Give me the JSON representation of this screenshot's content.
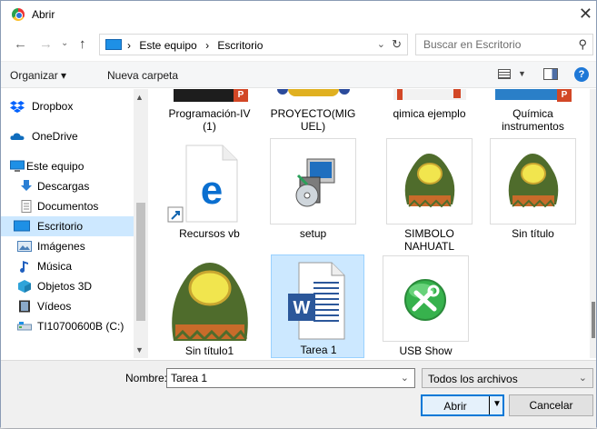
{
  "window": {
    "title": "Abrir",
    "close_glyph": "✕"
  },
  "nav": {
    "back_glyph": "←",
    "forward_glyph": "→",
    "recent_glyph": "⌄",
    "up_glyph": "↑",
    "breadcrumb": [
      "Este equipo",
      "Escritorio"
    ],
    "separator": "›",
    "refresh_glyph": "↻",
    "search_placeholder": "Buscar en Escritorio",
    "search_glyph": "⚲"
  },
  "toolbar": {
    "organize_label": "Organizar ▾",
    "new_folder_label": "Nueva carpeta",
    "help_glyph": "?"
  },
  "sidebar": {
    "items": [
      {
        "label": "Dropbox",
        "icon": "dropbox-icon",
        "color": "#0061fe"
      },
      {
        "label": "OneDrive",
        "icon": "onedrive-icon",
        "color": "#0f6cbd"
      },
      {
        "label": "Este equipo",
        "icon": "computer-icon",
        "color": "#1e90e6"
      },
      {
        "label": "Descargas",
        "icon": "download-icon",
        "color": "#2a7fd4"
      },
      {
        "label": "Documentos",
        "icon": "document-icon",
        "color": "#8a8a8a"
      },
      {
        "label": "Escritorio",
        "icon": "desktop-icon",
        "color": "#1e90e6",
        "selected": true
      },
      {
        "label": "Imágenes",
        "icon": "pictures-icon",
        "color": "#4a7fb8"
      },
      {
        "label": "Música",
        "icon": "music-icon",
        "color": "#1f5fbf"
      },
      {
        "label": "Objetos 3D",
        "icon": "objects-3d-icon",
        "color": "#2fa3d9"
      },
      {
        "label": "Vídeos",
        "icon": "video-icon",
        "color": "#333333"
      },
      {
        "label": "TI10700600B (C:)",
        "icon": "drive-icon",
        "color": "#6b8fb3"
      }
    ]
  },
  "files": {
    "row1": [
      {
        "name": "Programación-IV\n(1)",
        "icon": "presentation-icon"
      },
      {
        "name": "PROYECTO(MIG\nUEL)",
        "icon": "image-icon"
      },
      {
        "name": "qimica ejemplo",
        "icon": "presentation-icon"
      },
      {
        "name": "Química\ninstrumentos",
        "icon": "presentation-icon"
      }
    ],
    "row2": [
      {
        "name": "Recursos vb",
        "icon": "edge-shortcut-icon"
      },
      {
        "name": "setup",
        "icon": "installer-icon"
      },
      {
        "name": "SIMBOLO\nNAHUATL",
        "icon": "nahuatl-image-icon"
      },
      {
        "name": "Sin título",
        "icon": "nahuatl-image-icon"
      }
    ],
    "row3": [
      {
        "name": "Sin título1",
        "icon": "nahuatl-image-icon"
      },
      {
        "name": "Tarea 1",
        "icon": "word-document-icon",
        "selected": true
      },
      {
        "name": "USB Show",
        "icon": "usb-show-icon"
      }
    ]
  },
  "footer": {
    "filename_label": "Nombre:",
    "filename_value": "Tarea 1",
    "filetype_value": "Todos los archivos",
    "open_label": "Abrir",
    "cancel_label": "Cancelar",
    "dropdown_glyph": "⌄"
  },
  "colors": {
    "accent": "#0078d7",
    "selection": "#cce8ff",
    "word_blue": "#2b579a",
    "usb_green": "#37b24d"
  }
}
